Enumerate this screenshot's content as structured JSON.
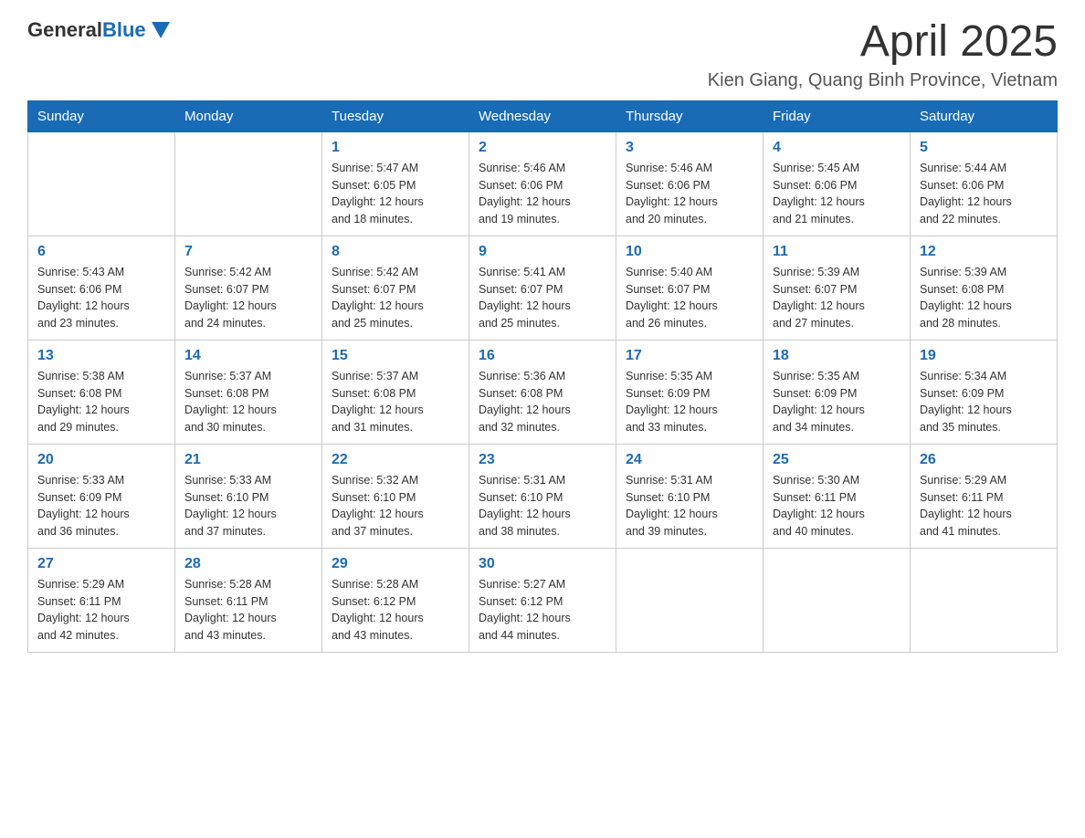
{
  "header": {
    "logo_general": "General",
    "logo_blue": "Blue",
    "month_year": "April 2025",
    "location": "Kien Giang, Quang Binh Province, Vietnam"
  },
  "weekdays": [
    "Sunday",
    "Monday",
    "Tuesday",
    "Wednesday",
    "Thursday",
    "Friday",
    "Saturday"
  ],
  "weeks": [
    [
      {
        "day": "",
        "info": ""
      },
      {
        "day": "",
        "info": ""
      },
      {
        "day": "1",
        "info": "Sunrise: 5:47 AM\nSunset: 6:05 PM\nDaylight: 12 hours\nand 18 minutes."
      },
      {
        "day": "2",
        "info": "Sunrise: 5:46 AM\nSunset: 6:06 PM\nDaylight: 12 hours\nand 19 minutes."
      },
      {
        "day": "3",
        "info": "Sunrise: 5:46 AM\nSunset: 6:06 PM\nDaylight: 12 hours\nand 20 minutes."
      },
      {
        "day": "4",
        "info": "Sunrise: 5:45 AM\nSunset: 6:06 PM\nDaylight: 12 hours\nand 21 minutes."
      },
      {
        "day": "5",
        "info": "Sunrise: 5:44 AM\nSunset: 6:06 PM\nDaylight: 12 hours\nand 22 minutes."
      }
    ],
    [
      {
        "day": "6",
        "info": "Sunrise: 5:43 AM\nSunset: 6:06 PM\nDaylight: 12 hours\nand 23 minutes."
      },
      {
        "day": "7",
        "info": "Sunrise: 5:42 AM\nSunset: 6:07 PM\nDaylight: 12 hours\nand 24 minutes."
      },
      {
        "day": "8",
        "info": "Sunrise: 5:42 AM\nSunset: 6:07 PM\nDaylight: 12 hours\nand 25 minutes."
      },
      {
        "day": "9",
        "info": "Sunrise: 5:41 AM\nSunset: 6:07 PM\nDaylight: 12 hours\nand 25 minutes."
      },
      {
        "day": "10",
        "info": "Sunrise: 5:40 AM\nSunset: 6:07 PM\nDaylight: 12 hours\nand 26 minutes."
      },
      {
        "day": "11",
        "info": "Sunrise: 5:39 AM\nSunset: 6:07 PM\nDaylight: 12 hours\nand 27 minutes."
      },
      {
        "day": "12",
        "info": "Sunrise: 5:39 AM\nSunset: 6:08 PM\nDaylight: 12 hours\nand 28 minutes."
      }
    ],
    [
      {
        "day": "13",
        "info": "Sunrise: 5:38 AM\nSunset: 6:08 PM\nDaylight: 12 hours\nand 29 minutes."
      },
      {
        "day": "14",
        "info": "Sunrise: 5:37 AM\nSunset: 6:08 PM\nDaylight: 12 hours\nand 30 minutes."
      },
      {
        "day": "15",
        "info": "Sunrise: 5:37 AM\nSunset: 6:08 PM\nDaylight: 12 hours\nand 31 minutes."
      },
      {
        "day": "16",
        "info": "Sunrise: 5:36 AM\nSunset: 6:08 PM\nDaylight: 12 hours\nand 32 minutes."
      },
      {
        "day": "17",
        "info": "Sunrise: 5:35 AM\nSunset: 6:09 PM\nDaylight: 12 hours\nand 33 minutes."
      },
      {
        "day": "18",
        "info": "Sunrise: 5:35 AM\nSunset: 6:09 PM\nDaylight: 12 hours\nand 34 minutes."
      },
      {
        "day": "19",
        "info": "Sunrise: 5:34 AM\nSunset: 6:09 PM\nDaylight: 12 hours\nand 35 minutes."
      }
    ],
    [
      {
        "day": "20",
        "info": "Sunrise: 5:33 AM\nSunset: 6:09 PM\nDaylight: 12 hours\nand 36 minutes."
      },
      {
        "day": "21",
        "info": "Sunrise: 5:33 AM\nSunset: 6:10 PM\nDaylight: 12 hours\nand 37 minutes."
      },
      {
        "day": "22",
        "info": "Sunrise: 5:32 AM\nSunset: 6:10 PM\nDaylight: 12 hours\nand 37 minutes."
      },
      {
        "day": "23",
        "info": "Sunrise: 5:31 AM\nSunset: 6:10 PM\nDaylight: 12 hours\nand 38 minutes."
      },
      {
        "day": "24",
        "info": "Sunrise: 5:31 AM\nSunset: 6:10 PM\nDaylight: 12 hours\nand 39 minutes."
      },
      {
        "day": "25",
        "info": "Sunrise: 5:30 AM\nSunset: 6:11 PM\nDaylight: 12 hours\nand 40 minutes."
      },
      {
        "day": "26",
        "info": "Sunrise: 5:29 AM\nSunset: 6:11 PM\nDaylight: 12 hours\nand 41 minutes."
      }
    ],
    [
      {
        "day": "27",
        "info": "Sunrise: 5:29 AM\nSunset: 6:11 PM\nDaylight: 12 hours\nand 42 minutes."
      },
      {
        "day": "28",
        "info": "Sunrise: 5:28 AM\nSunset: 6:11 PM\nDaylight: 12 hours\nand 43 minutes."
      },
      {
        "day": "29",
        "info": "Sunrise: 5:28 AM\nSunset: 6:12 PM\nDaylight: 12 hours\nand 43 minutes."
      },
      {
        "day": "30",
        "info": "Sunrise: 5:27 AM\nSunset: 6:12 PM\nDaylight: 12 hours\nand 44 minutes."
      },
      {
        "day": "",
        "info": ""
      },
      {
        "day": "",
        "info": ""
      },
      {
        "day": "",
        "info": ""
      }
    ]
  ]
}
